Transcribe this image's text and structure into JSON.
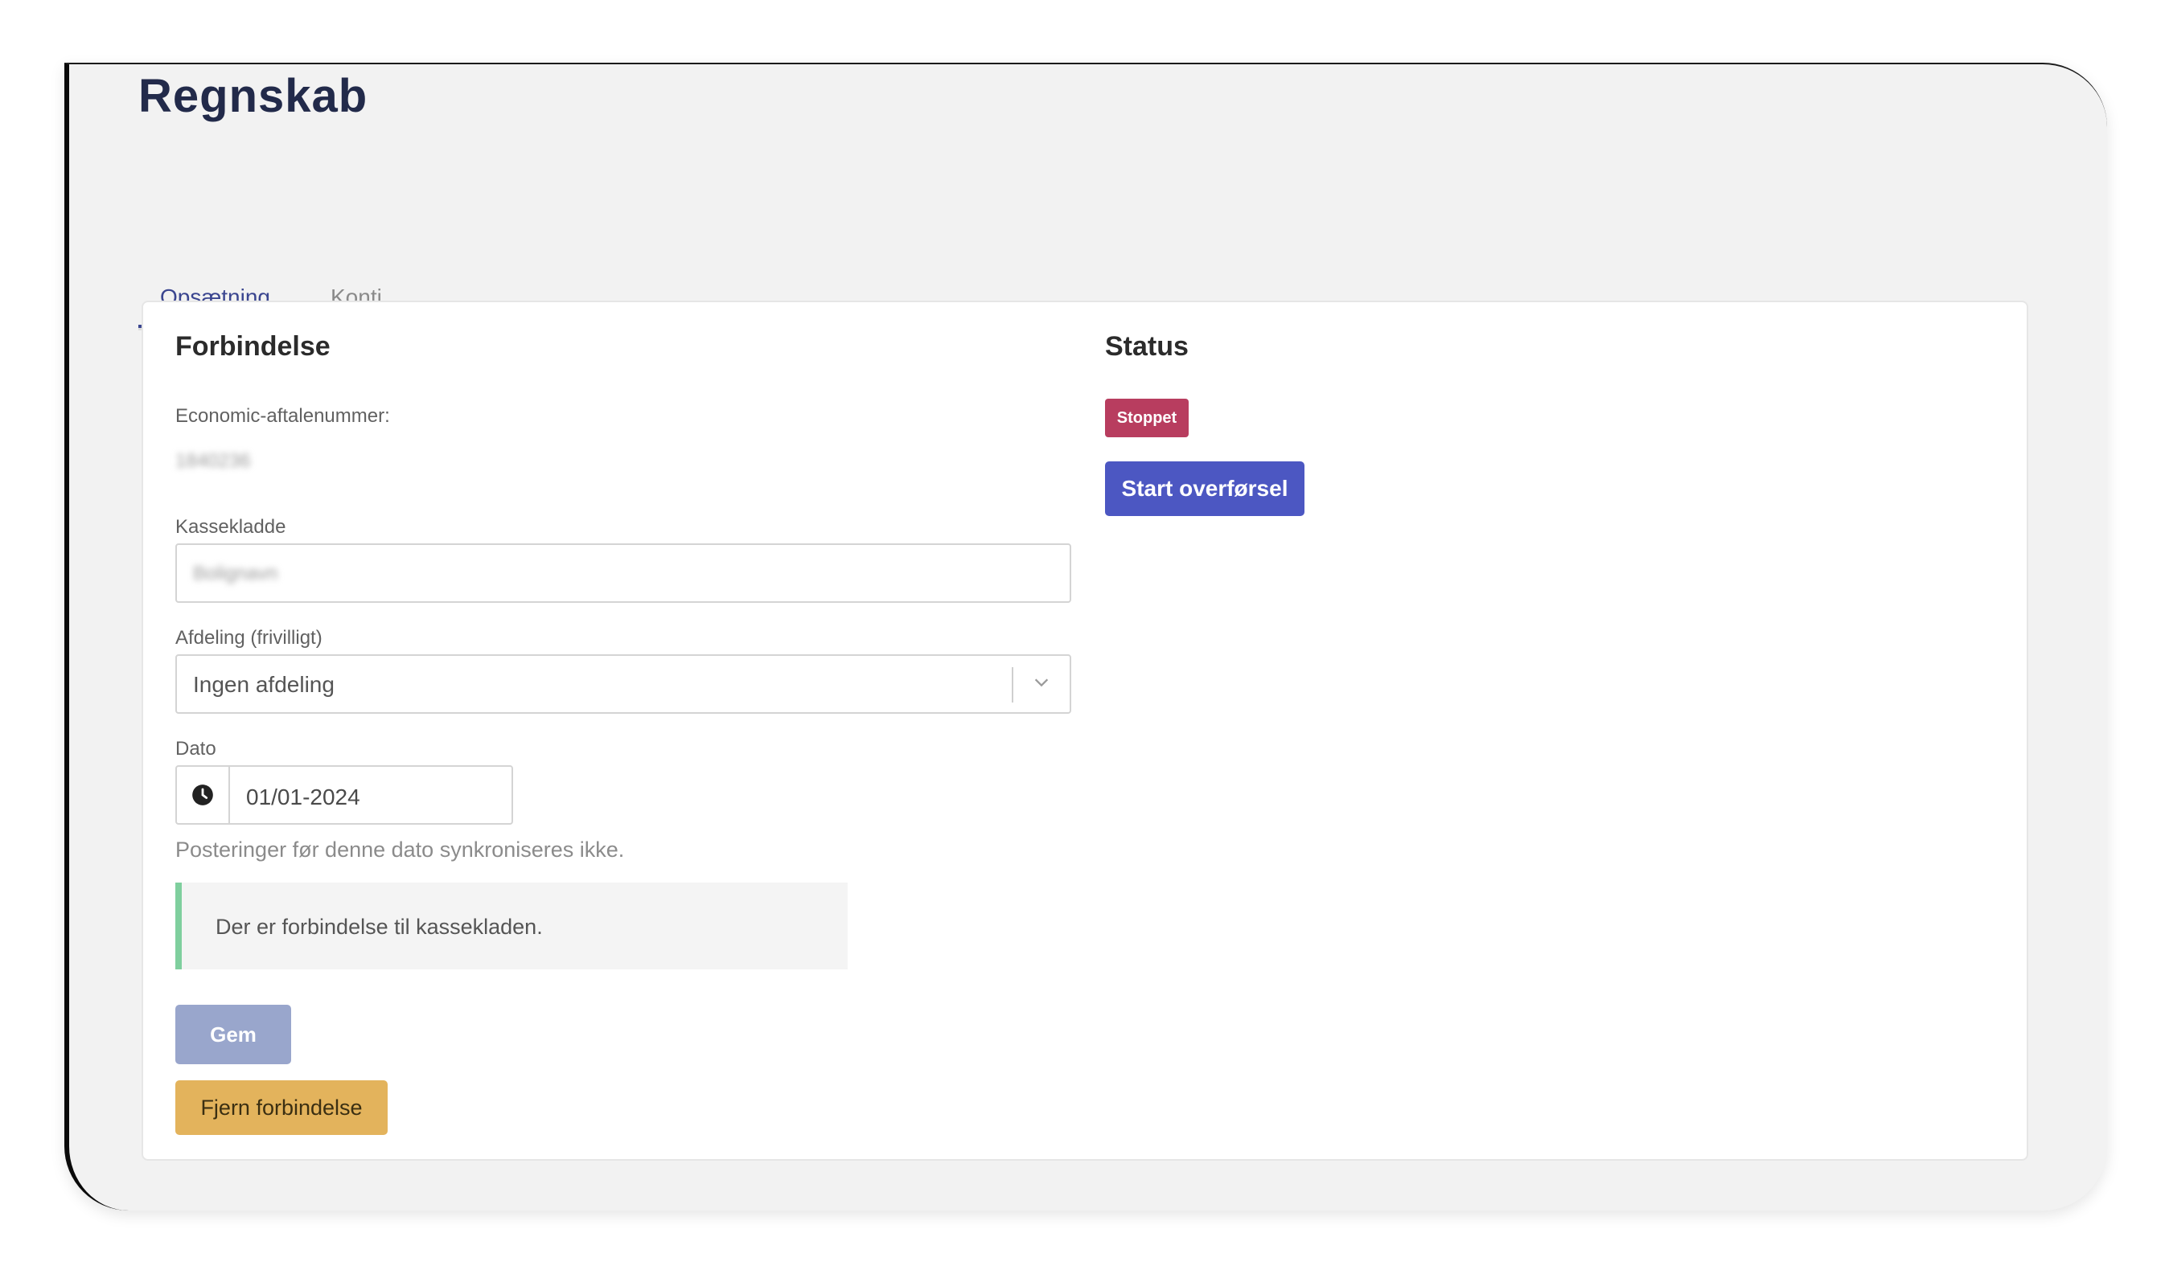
{
  "page": {
    "title": "Regnskab"
  },
  "tabs": [
    {
      "label": "Opsætning",
      "active": true
    },
    {
      "label": "Konti",
      "active": false
    }
  ],
  "connection": {
    "title": "Forbindelse",
    "agreement_label": "Economic-aftalenummer:",
    "agreement_value": "1840236",
    "cashbook_label": "Kassekladde",
    "cashbook_value": "Bolignavn",
    "department_label": "Afdeling (frivilligt)",
    "department_value": "Ingen afdeling",
    "date_label": "Dato",
    "date_value": "01/01-2024",
    "date_hint": "Posteringer før denne dato synkroniseres ikke.",
    "alert_text": "Der er forbindelse til kassekladen.",
    "save_label": "Gem",
    "remove_label": "Fjern forbindelse"
  },
  "status": {
    "title": "Status",
    "badge": "Stoppet",
    "start_label": "Start overførsel"
  },
  "colors": {
    "accent": "#3b4690",
    "badge_stopped": "#b83d5f",
    "start_button": "#4c57c2",
    "save_button": "#99a6cc",
    "remove_button": "#e3b35c",
    "alert_border": "#7fcf9e"
  },
  "icons": {
    "date": "clock-icon",
    "select": "chevron-down-icon"
  }
}
